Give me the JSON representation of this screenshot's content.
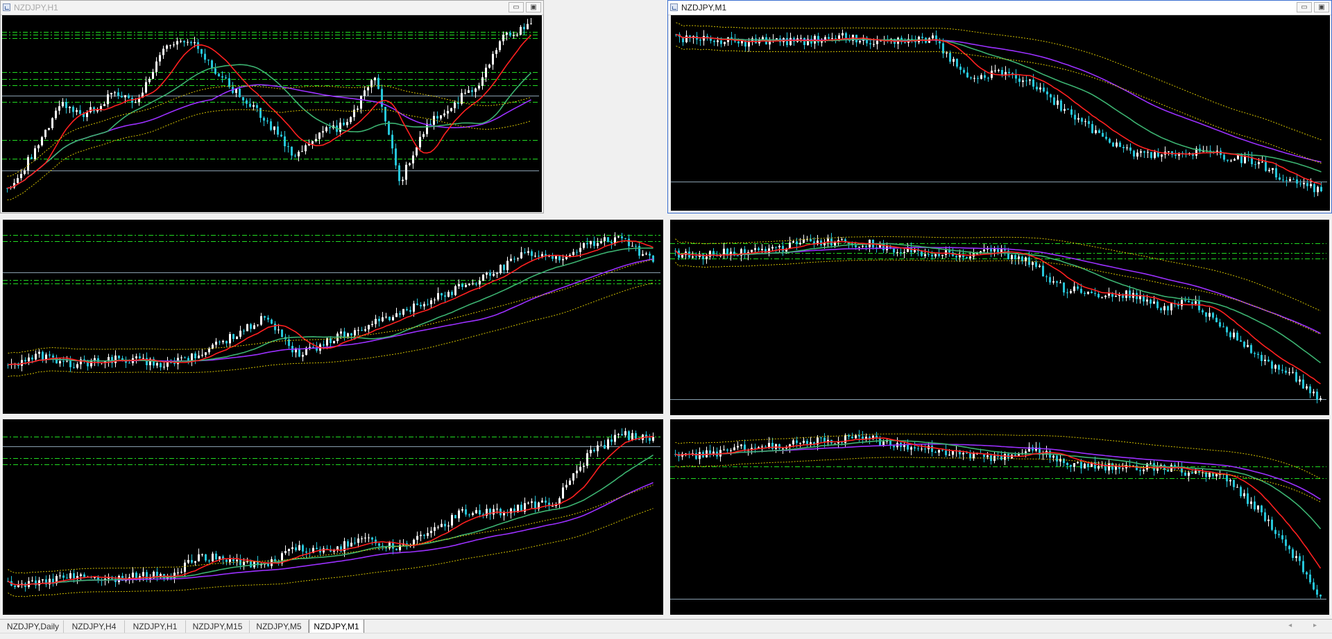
{
  "windows": [
    {
      "id": "w1",
      "title": "NZDJPY,H1",
      "active": false,
      "hlines": [
        0.085,
        0.1,
        0.115,
        0.29,
        0.325,
        0.355,
        0.41,
        0.44,
        0.635,
        0.73,
        0.79
      ],
      "trend": [
        0.9,
        0.7,
        0.45,
        0.5,
        0.4,
        0.45,
        0.15,
        0.12,
        0.3,
        0.42,
        0.55,
        0.72,
        0.6,
        0.55,
        0.3,
        0.85,
        0.55,
        0.45,
        0.35,
        0.1,
        0.06
      ]
    },
    {
      "id": "w2",
      "title": "NZDJPY,M1",
      "active": true,
      "hlines": [
        0.85
      ],
      "trend": [
        0.12,
        0.12,
        0.14,
        0.13,
        0.14,
        0.1,
        0.14,
        0.12,
        0.12,
        0.32,
        0.3,
        0.35,
        0.48,
        0.6,
        0.7,
        0.72,
        0.7,
        0.72,
        0.75,
        0.85,
        0.9
      ]
    },
    {
      "id": "w3",
      "title": "",
      "active": false,
      "hlines": [
        0.08,
        0.11,
        0.27,
        0.31,
        0.33
      ],
      "trend": [
        0.77,
        0.7,
        0.75,
        0.72,
        0.72,
        0.75,
        0.68,
        0.6,
        0.5,
        0.7,
        0.62,
        0.55,
        0.5,
        0.42,
        0.35,
        0.28,
        0.18,
        0.2,
        0.12,
        0.1,
        0.22
      ]
    },
    {
      "id": "w4",
      "title": "",
      "active": false,
      "hlines": [
        0.12,
        0.17,
        0.2,
        0.92
      ],
      "trend": [
        0.18,
        0.18,
        0.16,
        0.16,
        0.1,
        0.12,
        0.12,
        0.16,
        0.17,
        0.18,
        0.16,
        0.22,
        0.35,
        0.38,
        0.38,
        0.45,
        0.42,
        0.55,
        0.7,
        0.78,
        0.92
      ]
    },
    {
      "id": "w5",
      "title": "",
      "active": false,
      "hlines": [
        0.09,
        0.14,
        0.2,
        0.23
      ],
      "trend": [
        0.85,
        0.83,
        0.8,
        0.82,
        0.8,
        0.8,
        0.7,
        0.72,
        0.75,
        0.66,
        0.68,
        0.6,
        0.66,
        0.6,
        0.48,
        0.48,
        0.45,
        0.42,
        0.18,
        0.08,
        0.1
      ]
    },
    {
      "id": "w6",
      "title": "",
      "active": false,
      "hlines": [
        0.24,
        0.3,
        0.3,
        0.92
      ],
      "trend": [
        0.2,
        0.18,
        0.14,
        0.14,
        0.12,
        0.1,
        0.1,
        0.14,
        0.16,
        0.18,
        0.2,
        0.14,
        0.22,
        0.24,
        0.25,
        0.24,
        0.28,
        0.3,
        0.45,
        0.65,
        0.92
      ]
    }
  ],
  "tabs": [
    {
      "label": "NZDJPY,Daily",
      "active": false
    },
    {
      "label": "NZDJPY,H4",
      "active": false
    },
    {
      "label": "NZDJPY,H1",
      "active": false
    },
    {
      "label": "NZDJPY,M15",
      "active": false
    },
    {
      "label": "NZDJPY,M5",
      "active": false
    },
    {
      "label": "NZDJPY,M1",
      "active": true
    }
  ],
  "window_buttons": {
    "minimize": "▭",
    "maximize": "▣"
  },
  "colors": {
    "background": "#000000",
    "candle": "#ffffff",
    "candle_down": "#26c6da",
    "ma_fast": "#ff2020",
    "ma_mid": "#3cb371",
    "ma_slow": "#9b30ff",
    "envelope": "#d4c200",
    "level": "#22dd22",
    "price_line": "#8aa0b0"
  },
  "icons": {
    "window": "chart-window-icon",
    "tab_scroll": "◂ ▸"
  }
}
